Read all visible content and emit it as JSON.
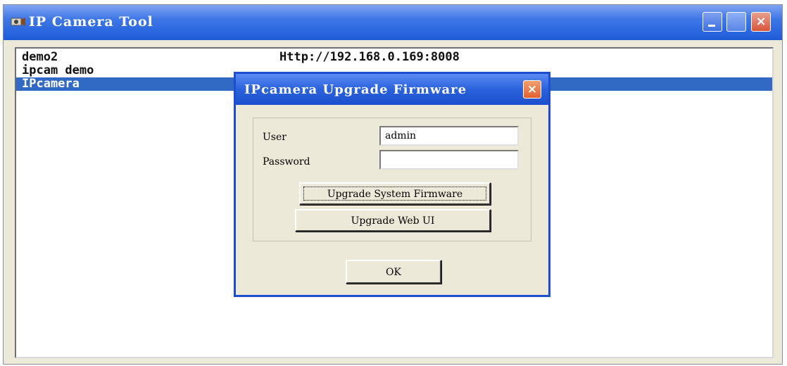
{
  "window": {
    "title": "IP Camera Tool",
    "icons": [
      "camera-app-icon",
      "minimize-icon",
      "maximize-icon",
      "close-icon"
    ]
  },
  "camera_list": [
    {
      "name": "demo2",
      "url": "Http://192.168.0.169:8008",
      "selected": false
    },
    {
      "name": "ipcam demo",
      "url": "",
      "selected": false
    },
    {
      "name": "IPcamera",
      "url": "",
      "selected": true
    }
  ],
  "dialog": {
    "title": "IPcamera Upgrade Firmware",
    "close_icon": "close-icon",
    "user_label": "User",
    "user_value": "admin",
    "password_label": "Password",
    "password_value": "",
    "upgrade_system_label": "Upgrade System Firmware",
    "upgrade_web_label": "Upgrade Web UI",
    "ok_label": "OK"
  },
  "colors": {
    "titlebar": "#1d5bd8",
    "selection": "#316ac5",
    "window_bg": "#ece9d8",
    "close_button": "#e06030"
  }
}
